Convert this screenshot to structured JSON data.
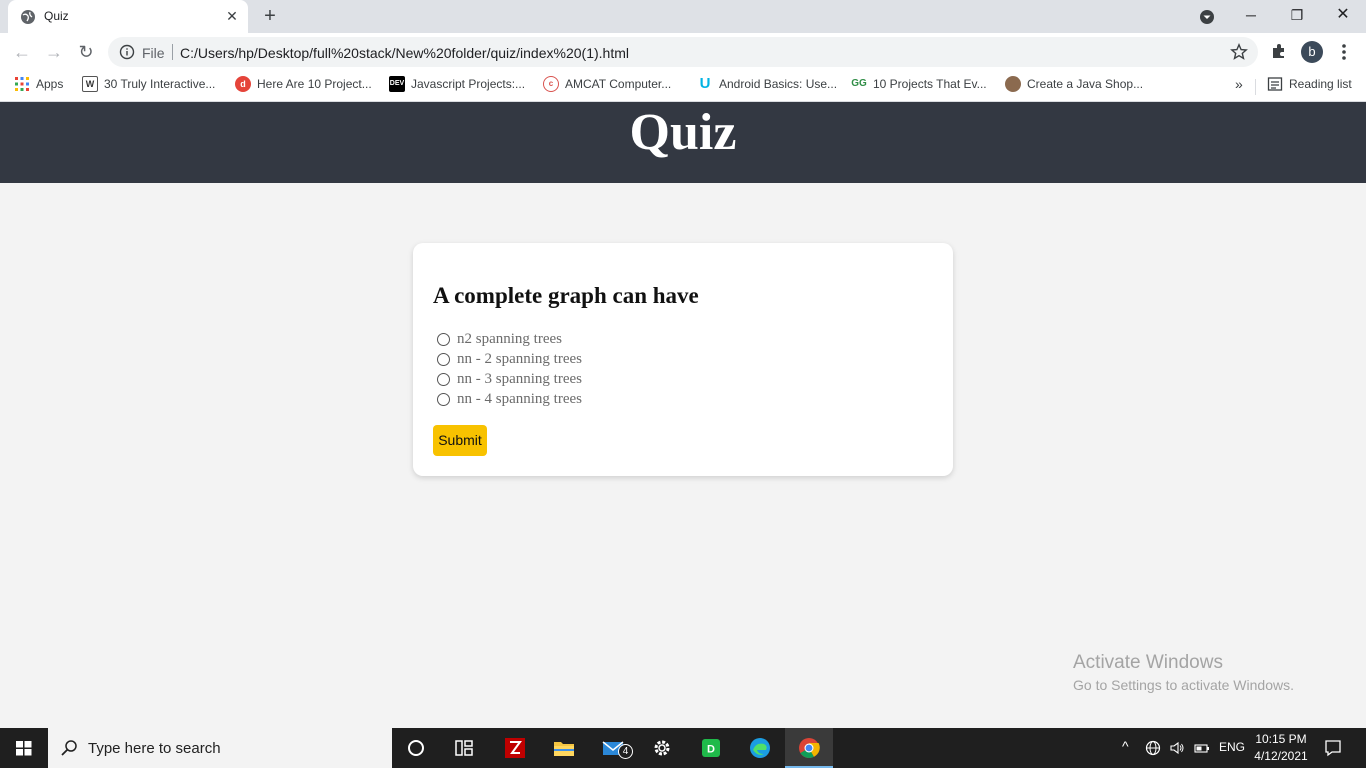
{
  "browser": {
    "tab_title": "Quiz",
    "scheme_label": "File",
    "url": "C:/Users/hp/Desktop/full%20stack/New%20folder/quiz/index%20(1).html",
    "profile_initial": "b",
    "bookmarks": [
      {
        "label": "Apps",
        "icon": "apps-grid-icon"
      },
      {
        "label": "30 Truly Interactive...",
        "icon": "w-favicon"
      },
      {
        "label": "Here Are 10 Project...",
        "icon": "red-favicon"
      },
      {
        "label": "Javascript Projects:...",
        "icon": "dev-favicon",
        "icon_text": "DEV"
      },
      {
        "label": "AMCAT Computer...",
        "icon": "amcat-favicon"
      },
      {
        "label": "Android Basics: Use...",
        "icon": "udacity-favicon"
      },
      {
        "label": "10 Projects That Ev...",
        "icon": "gfg-favicon"
      },
      {
        "label": "Create a Java Shop...",
        "icon": "java-favicon"
      }
    ],
    "overflow_label": "»",
    "reading_list_label": "Reading list"
  },
  "page": {
    "header_title": "Quiz",
    "question": "A complete graph can have",
    "options": [
      "n2 spanning trees",
      "nn - 2 spanning trees",
      "nn - 3 spanning trees",
      "nn - 4 spanning trees"
    ],
    "submit_label": "Submit"
  },
  "watermark": {
    "line1": "Activate Windows",
    "line2": "Go to Settings to activate Windows."
  },
  "taskbar": {
    "search_placeholder": "Type here to search",
    "mail_badge": "4",
    "language": "ENG",
    "time": "10:15 PM",
    "date": "4/12/2021"
  },
  "colors": {
    "header_bg": "#333842",
    "page_bg": "#f3f3f3",
    "submit_bg": "#f8c200"
  }
}
